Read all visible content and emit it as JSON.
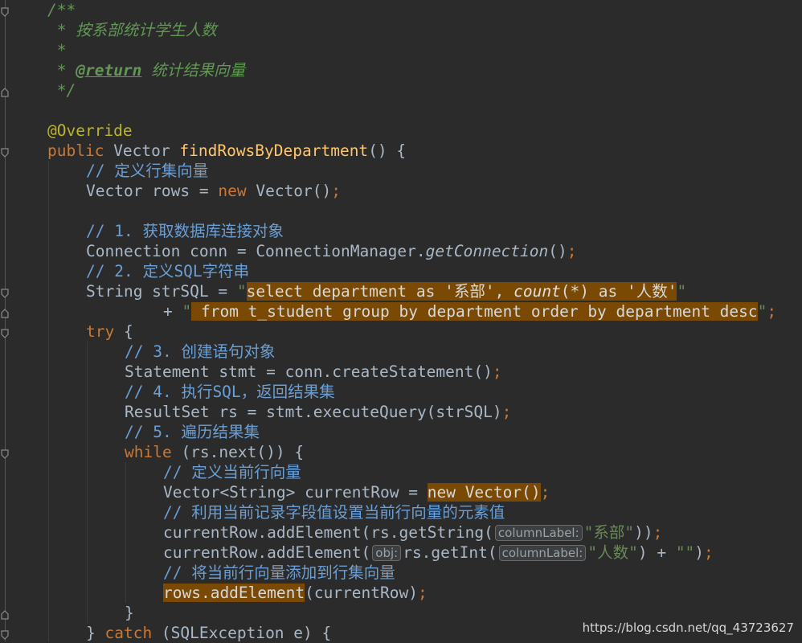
{
  "doc_comment": {
    "open": "/**",
    "line1": " * 按系部统计学生人数",
    "line2": " *",
    "line3_star": " * ",
    "return_tag": "@return",
    "return_desc": " 统计结果向量",
    "close": " */"
  },
  "annotation": "@Override",
  "method": {
    "modifier": "public",
    "return_type": " Vector ",
    "name": "findRowsByDepartment",
    "params": "() {"
  },
  "code": {
    "c_define_rows": "// 定义行集向量",
    "rows_decl_a": "Vector rows = ",
    "kw_new": "new",
    "rows_decl_b": " Vector()",
    "semicolon": ";",
    "c_step1": "// 1. 获取数据库连接对象",
    "conn_decl_a": "Connection conn = ConnectionManager.",
    "conn_method": "getConnection",
    "conn_decl_b": "()",
    "c_step2": "// 2. 定义SQL字符串",
    "sql_decl_a": "String strSQL = ",
    "quote": "\"",
    "sql_part1_a": "select department as '系部', ",
    "sql_count": "count",
    "sql_part1_b": "(*) as '人数'",
    "sql_plus": "+ ",
    "sql_part2": " from t_student group by department order by department desc",
    "kw_try": "try",
    "brace_open": " {",
    "c_step3": "// 3. 创建语句对象",
    "stmt_decl": "Statement stmt = conn.createStatement()",
    "c_step4": "// 4. 执行SQL，返回结果集",
    "rs_decl": "ResultSet rs = stmt.executeQuery(strSQL)",
    "c_step5": "// 5. 遍历结果集",
    "kw_while": "while",
    "while_cond": " (rs.next()) {",
    "c_define_row": "// 定义当前行向量",
    "row_decl_a": "Vector<String> currentRow = ",
    "row_decl_new": "new Vector()",
    "c_fill_row": "// 利用当前记录字段值设置当前行向量的元素值",
    "add1_a": "currentRow.addElement(rs.getString(",
    "hint_column_label": "columnLabel:",
    "add1_str": "\"系部\"",
    "add1_b": "))",
    "add2_a": "currentRow.addElement(",
    "hint_obj": "obj:",
    "add2_b": "rs.getInt(",
    "add2_str": "\"人数\"",
    "add2_c": ") + ",
    "empty_str": "\"\"",
    "add2_d": ")",
    "c_add_row": "// 将当前行向量添加到行集向量",
    "add_rows_a": "rows.addElement",
    "add_rows_b": "(currentRow)",
    "brace_close": "}",
    "catch_close": "} ",
    "kw_catch": "catch",
    "catch_b": " (SQLException e) {"
  },
  "watermark": "https://blog.csdn.net/qq_43723627"
}
